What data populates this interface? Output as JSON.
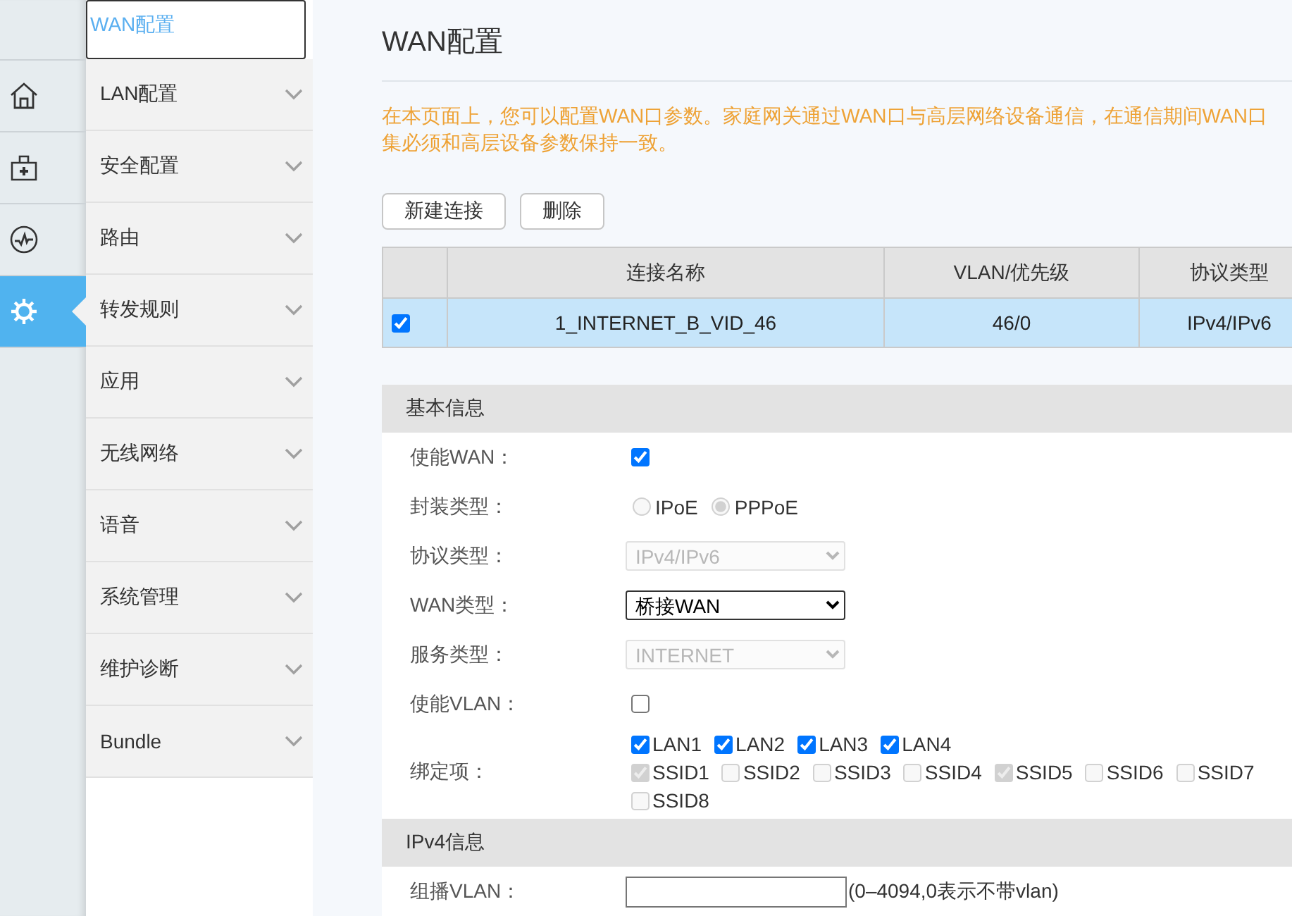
{
  "nav_rail": [
    {
      "selected": false
    },
    {
      "selected": false
    },
    {
      "selected": false
    },
    {
      "selected": true
    }
  ],
  "sidebar": {
    "items": [
      {
        "label": "WAN配置",
        "kind": "link",
        "selected": true
      },
      {
        "label": "LAN配置",
        "kind": "group",
        "selected": false,
        "expanded": false
      },
      {
        "label": "安全配置",
        "kind": "group",
        "selected": false,
        "expanded": false
      },
      {
        "label": "路由",
        "kind": "group",
        "selected": false,
        "expanded": false
      },
      {
        "label": "转发规则",
        "kind": "group",
        "selected": false,
        "expanded": false
      },
      {
        "label": "应用",
        "kind": "group",
        "selected": false,
        "expanded": false
      },
      {
        "label": "无线网络",
        "kind": "group",
        "selected": false,
        "expanded": false
      },
      {
        "label": "语音",
        "kind": "group",
        "selected": false,
        "expanded": false
      },
      {
        "label": "系统管理",
        "kind": "group",
        "selected": false,
        "expanded": false
      },
      {
        "label": "维护诊断",
        "kind": "group",
        "selected": false,
        "expanded": false
      },
      {
        "label": "Bundle",
        "kind": "group",
        "selected": false,
        "expanded": false
      }
    ]
  },
  "page": {
    "title": "WAN配置",
    "description": [
      "在本页面上，您可以配置WAN口参数。家庭网关通过WAN口与高层网络设备通信，在通信期间WAN口",
      "集必须和高层设备参数保持一致。"
    ],
    "buttons": [
      "新建连接",
      "删除"
    ]
  },
  "table": {
    "columns": [
      "连接名称",
      "VLAN/优先级",
      "协议类型"
    ],
    "rows": [
      {
        "selected": true,
        "checked": true,
        "cells": [
          "1_INTERNET_B_VID_46",
          "46/0",
          "IPv4/IPv6"
        ]
      }
    ]
  },
  "sections": [
    {
      "title": "基本信息",
      "fields": [
        {
          "kind": "checkbox",
          "label": "使能WAN：",
          "checked": true
        },
        {
          "kind": "radio",
          "label": "封装类型：",
          "disabled": true,
          "options": [
            {
              "label": "IPoE",
              "selected": false
            },
            {
              "label": "PPPoE",
              "selected": true
            }
          ]
        },
        {
          "kind": "select",
          "label": "协议类型：",
          "value": "IPv4/IPv6",
          "disabled": true
        },
        {
          "kind": "select",
          "label": "WAN类型：",
          "value": "桥接WAN",
          "disabled": false
        },
        {
          "kind": "select",
          "label": "服务类型：",
          "value": "INTERNET",
          "disabled": true
        },
        {
          "kind": "checkbox",
          "label": "使能VLAN：",
          "checked": false
        },
        {
          "kind": "checkgroup",
          "label": "绑定项：",
          "groups": [
            {
              "options": [
                {
                  "label": "LAN1",
                  "checked": true,
                  "disabled": false
                },
                {
                  "label": "LAN2",
                  "checked": true,
                  "disabled": false
                },
                {
                  "label": "LAN3",
                  "checked": true,
                  "disabled": false
                },
                {
                  "label": "LAN4",
                  "checked": true,
                  "disabled": false
                }
              ]
            },
            {
              "options": [
                {
                  "label": "SSID1",
                  "checked": true,
                  "disabled": true
                },
                {
                  "label": "SSID2",
                  "checked": false,
                  "disabled": true
                },
                {
                  "label": "SSID3",
                  "checked": false,
                  "disabled": true
                },
                {
                  "label": "SSID4",
                  "checked": false,
                  "disabled": true
                },
                {
                  "label": "SSID5",
                  "checked": true,
                  "disabled": true
                },
                {
                  "label": "SSID6",
                  "checked": false,
                  "disabled": true
                },
                {
                  "label": "SSID7",
                  "checked": false,
                  "disabled": true
                },
                {
                  "label": "SSID8",
                  "checked": false,
                  "disabled": true
                }
              ]
            }
          ]
        }
      ]
    },
    {
      "title": "IPv4信息",
      "fields": [
        {
          "kind": "text",
          "label": "组播VLAN：",
          "hint": "(0–4094,0表示不带vlan)"
        }
      ]
    }
  ]
}
